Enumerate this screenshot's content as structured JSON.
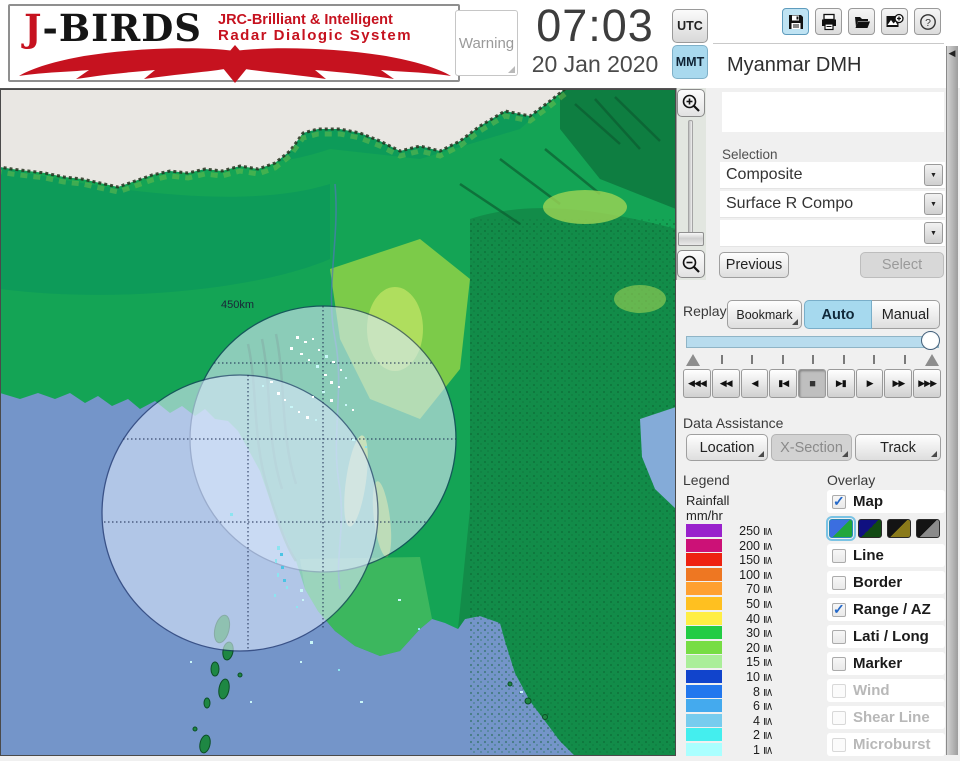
{
  "header": {
    "logo": {
      "j": "J",
      "rest": "-BIRDS",
      "sub1": "JRC-Brilliant & Intelligent",
      "sub2": "Radar  Dialogic  System"
    },
    "warning_label": "Warning",
    "time": "07:03",
    "date": "20 Jan 2020",
    "tz": [
      {
        "label": "UTC",
        "active": false
      },
      {
        "label": "MMT",
        "active": true
      }
    ],
    "toolbar_icons": [
      "save-icon",
      "print-icon",
      "open-folder-icon",
      "add-image-icon",
      "help-icon"
    ],
    "station": "Myanmar DMH"
  },
  "panel": {
    "selection": {
      "label": "Selection",
      "dropdowns": [
        {
          "value": "Composite"
        },
        {
          "value": "Surface R Compo"
        },
        {
          "value": ""
        }
      ],
      "previous_label": "Previous",
      "select_label": "Select"
    },
    "replay": {
      "label": "Replay",
      "bookmark_label": "Bookmark",
      "auto_label": "Auto",
      "manual_label": "Manual",
      "playback": {
        "glyphs": [
          "◀◀◀",
          "◀◀",
          "◀",
          "▮◀",
          "■",
          "▶▮",
          "▶",
          "▶▶",
          "▶▶▶"
        ],
        "names": [
          "fast-rewind-button",
          "rewind-button",
          "step-back-button",
          "skip-start-button",
          "stop-button",
          "skip-end-button",
          "play-button",
          "forward-button",
          "fast-forward-button"
        ],
        "active_index": 4
      }
    },
    "data_assistance": {
      "label": "Data Assistance",
      "buttons": [
        {
          "label": "Location",
          "enabled": true
        },
        {
          "label": "X-Section",
          "enabled": false
        },
        {
          "label": "Track",
          "enabled": true
        }
      ]
    },
    "legend": {
      "label": "Legend",
      "unit_line1": "Rainfall",
      "unit_line2": "mm/hr",
      "lte_glyph": "≦",
      "rows": [
        {
          "value": "250",
          "color": "#9922cc"
        },
        {
          "value": "200",
          "color": "#cc1177"
        },
        {
          "value": "150",
          "color": "#ee2211"
        },
        {
          "value": "100",
          "color": "#ee7722"
        },
        {
          "value": "70",
          "color": "#ffa030"
        },
        {
          "value": "50",
          "color": "#ffc020"
        },
        {
          "value": "40",
          "color": "#ffee44"
        },
        {
          "value": "30",
          "color": "#22cc44"
        },
        {
          "value": "20",
          "color": "#77dd44"
        },
        {
          "value": "15",
          "color": "#aaee99"
        },
        {
          "value": "10",
          "color": "#1144cc"
        },
        {
          "value": "8",
          "color": "#2277ee"
        },
        {
          "value": "6",
          "color": "#44aaee"
        },
        {
          "value": "4",
          "color": "#77ccee"
        },
        {
          "value": "2",
          "color": "#44eeee"
        },
        {
          "value": "1",
          "color": "#aaffff"
        }
      ]
    },
    "overlay": {
      "label": "Overlay",
      "items": [
        {
          "label": "Map",
          "checked": true,
          "enabled": true
        },
        {
          "label": "Line",
          "checked": false,
          "enabled": true
        },
        {
          "label": "Border",
          "checked": false,
          "enabled": true
        },
        {
          "label": "Range / AZ",
          "checked": true,
          "enabled": true
        },
        {
          "label": "Lati / Long",
          "checked": false,
          "enabled": true
        },
        {
          "label": "Marker",
          "checked": false,
          "enabled": true
        },
        {
          "label": "Wind",
          "checked": false,
          "enabled": false
        },
        {
          "label": "Shear Line",
          "checked": false,
          "enabled": false
        },
        {
          "label": "Microburst",
          "checked": false,
          "enabled": false
        }
      ],
      "map_swatches": [
        {
          "top": "#3b6ee0",
          "bottom": "#21a63c",
          "selected": true
        },
        {
          "top": "#101080",
          "bottom": "#124a14",
          "selected": false
        },
        {
          "top": "#141414",
          "bottom": "#8a7a1a",
          "selected": false
        },
        {
          "top": "#141414",
          "bottom": "#8a8a8a",
          "selected": false
        }
      ]
    }
  },
  "map": {
    "range_label": "450km",
    "sea_color": "#7495c9",
    "coverage_fill": "#dae8fb",
    "ring_color": "#14275e",
    "echo_colors": [
      "#ffffff",
      "#c8f6f8",
      "#8ce4f0",
      "#4cc4e4"
    ],
    "echoes": [
      [
        296,
        247,
        3,
        3,
        0
      ],
      [
        304,
        252,
        3,
        2,
        0
      ],
      [
        312,
        249,
        2,
        2,
        0
      ],
      [
        290,
        258,
        3,
        3,
        0
      ],
      [
        318,
        260,
        2,
        2,
        0
      ],
      [
        300,
        264,
        3,
        2,
        0
      ],
      [
        325,
        266,
        3,
        3,
        1
      ],
      [
        308,
        270,
        2,
        2,
        0
      ],
      [
        332,
        272,
        3,
        2,
        0
      ],
      [
        316,
        276,
        3,
        3,
        1
      ],
      [
        340,
        280,
        2,
        2,
        0
      ],
      [
        324,
        285,
        3,
        2,
        0
      ],
      [
        345,
        288,
        2,
        2,
        1
      ],
      [
        330,
        292,
        3,
        3,
        0
      ],
      [
        338,
        297,
        2,
        2,
        0
      ],
      [
        322,
        302,
        3,
        2,
        1
      ],
      [
        312,
        307,
        2,
        2,
        0
      ],
      [
        330,
        310,
        3,
        3,
        0
      ],
      [
        345,
        315,
        2,
        2,
        1
      ],
      [
        352,
        320,
        2,
        2,
        0
      ],
      [
        270,
        292,
        3,
        2,
        0
      ],
      [
        262,
        296,
        2,
        2,
        1
      ],
      [
        277,
        303,
        3,
        3,
        0
      ],
      [
        284,
        310,
        2,
        2,
        0
      ],
      [
        290,
        317,
        3,
        2,
        1
      ],
      [
        298,
        322,
        2,
        2,
        0
      ],
      [
        306,
        327,
        3,
        3,
        0
      ],
      [
        315,
        330,
        2,
        2,
        1
      ],
      [
        352,
        350,
        3,
        2,
        1
      ],
      [
        365,
        357,
        2,
        2,
        2
      ],
      [
        230,
        424,
        3,
        3,
        2
      ],
      [
        277,
        457,
        3,
        4,
        2
      ],
      [
        280,
        464,
        3,
        3,
        3
      ],
      [
        275,
        470,
        2,
        4,
        2
      ],
      [
        281,
        477,
        3,
        3,
        3
      ],
      [
        277,
        484,
        2,
        4,
        2
      ],
      [
        283,
        490,
        3,
        3,
        3
      ],
      [
        286,
        497,
        2,
        3,
        2
      ],
      [
        300,
        500,
        3,
        3,
        1
      ],
      [
        274,
        505,
        2,
        3,
        2
      ],
      [
        302,
        510,
        2,
        2,
        1
      ],
      [
        296,
        517,
        2,
        2,
        2
      ],
      [
        398,
        510,
        3,
        2,
        1
      ],
      [
        310,
        552,
        3,
        3,
        1
      ],
      [
        418,
        539,
        2,
        2,
        2
      ],
      [
        360,
        612,
        3,
        2,
        1
      ],
      [
        250,
        612,
        2,
        2,
        1
      ],
      [
        338,
        580,
        2,
        2,
        2
      ],
      [
        300,
        572,
        2,
        2,
        1
      ],
      [
        520,
        602,
        3,
        2,
        1
      ],
      [
        190,
        572,
        2,
        2,
        1
      ]
    ]
  }
}
